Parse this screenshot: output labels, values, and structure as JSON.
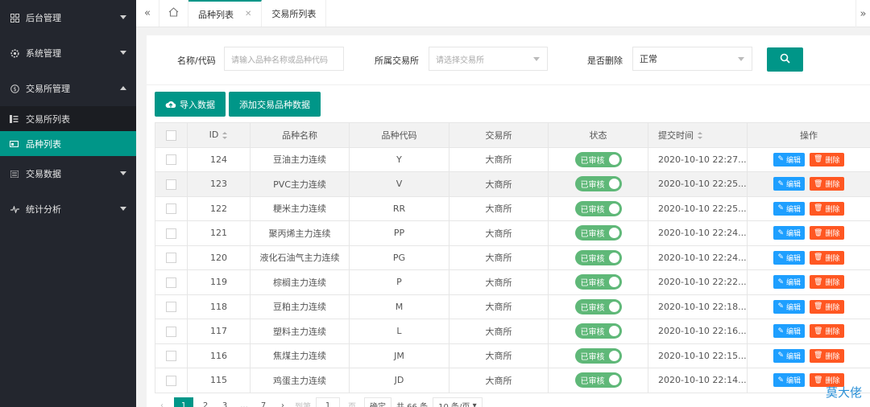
{
  "sidebar": {
    "items": [
      {
        "label": "后台管理",
        "icon": "grid-icon"
      },
      {
        "label": "系统管理",
        "icon": "gear-icon"
      },
      {
        "label": "交易所管理",
        "icon": "coin-icon"
      },
      {
        "label": "交易数据",
        "icon": "list-icon"
      },
      {
        "label": "统计分析",
        "icon": "chart-line-icon"
      }
    ],
    "sub_items": [
      {
        "label": "交易所列表",
        "icon": "list-detail-icon"
      },
      {
        "label": "品种列表",
        "icon": "card-icon"
      }
    ]
  },
  "tabs": [
    {
      "label": "品种列表",
      "close": "✕"
    },
    {
      "label": "交易所列表"
    }
  ],
  "filters": {
    "name_label": "名称/代码",
    "name_placeholder": "请输入品种名称或品种代码",
    "exchange_label": "所属交易所",
    "exchange_placeholder": "请选择交易所",
    "deleted_label": "是否删除",
    "deleted_value": "正常"
  },
  "actions": {
    "import_label": "导入数据",
    "add_label": "添加交易品种数据"
  },
  "table": {
    "headers": {
      "id": "ID",
      "name": "品种名称",
      "code": "品种代码",
      "exchange": "交易所",
      "status": "状态",
      "time": "提交时间",
      "ops": "操作"
    },
    "status_label": "已审核",
    "edit_label": "编辑",
    "delete_label": "删除",
    "rows": [
      {
        "id": "124",
        "name": "豆油主力连续",
        "code": "Y",
        "exchange": "大商所",
        "time": "2020-10-10 22:27..."
      },
      {
        "id": "123",
        "name": "PVC主力连续",
        "code": "V",
        "exchange": "大商所",
        "time": "2020-10-10 22:25..."
      },
      {
        "id": "122",
        "name": "粳米主力连续",
        "code": "RR",
        "exchange": "大商所",
        "time": "2020-10-10 22:25..."
      },
      {
        "id": "121",
        "name": "聚丙烯主力连续",
        "code": "PP",
        "exchange": "大商所",
        "time": "2020-10-10 22:24..."
      },
      {
        "id": "120",
        "name": "液化石油气主力连续",
        "code": "PG",
        "exchange": "大商所",
        "time": "2020-10-10 22:24..."
      },
      {
        "id": "119",
        "name": "棕榈主力连续",
        "code": "P",
        "exchange": "大商所",
        "time": "2020-10-10 22:22..."
      },
      {
        "id": "118",
        "name": "豆粕主力连续",
        "code": "M",
        "exchange": "大商所",
        "time": "2020-10-10 22:18..."
      },
      {
        "id": "117",
        "name": "塑料主力连续",
        "code": "L",
        "exchange": "大商所",
        "time": "2020-10-10 22:16..."
      },
      {
        "id": "116",
        "name": "焦煤主力连续",
        "code": "JM",
        "exchange": "大商所",
        "time": "2020-10-10 22:15..."
      },
      {
        "id": "115",
        "name": "鸡蛋主力连续",
        "code": "JD",
        "exchange": "大商所",
        "time": "2020-10-10 22:14..."
      }
    ]
  },
  "pagination": {
    "pages": [
      "1",
      "2",
      "3",
      "...",
      "7"
    ],
    "goto_label": "到第",
    "goto_value": "1",
    "page_unit": "页",
    "confirm": "确定",
    "total": "共 66 条",
    "per_page": "10 条/页"
  },
  "watermark": "莫大佬",
  "colors": {
    "accent": "#009688",
    "edit": "#1e9fff",
    "delete": "#ff5722",
    "switch": "#5fb878",
    "sidebar": "#23262e"
  }
}
